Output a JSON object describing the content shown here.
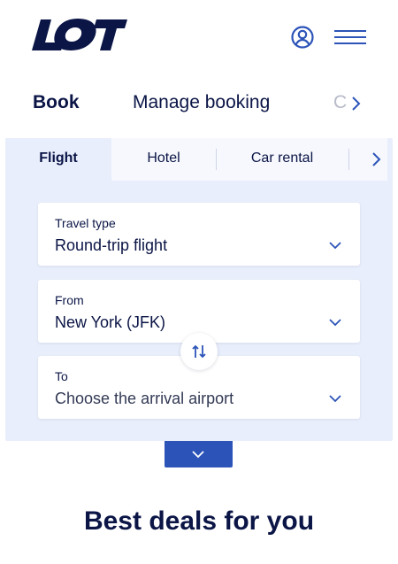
{
  "header": {
    "logo_text": "LOT",
    "user_icon": "user-circle-icon",
    "menu_icon": "hamburger-menu-icon"
  },
  "main_tabs": {
    "items": [
      {
        "label": "Book",
        "active": true
      },
      {
        "label": "Manage booking",
        "active": false
      },
      {
        "label": "C",
        "active": false
      }
    ],
    "next_icon": "chevron-right-icon"
  },
  "booking_panel": {
    "sub_tabs": [
      {
        "label": "Flight",
        "active": true
      },
      {
        "label": "Hotel",
        "active": false
      },
      {
        "label": "Car rental",
        "active": false
      }
    ],
    "fields": {
      "travel_type": {
        "label": "Travel type",
        "value": "Round-trip flight"
      },
      "from": {
        "label": "From",
        "value": "New York (JFK)"
      },
      "to": {
        "label": "To",
        "value": "Choose the arrival airport"
      }
    },
    "swap_icon": "swap-arrows-icon",
    "expand_icon": "chevron-down-icon"
  },
  "deals": {
    "title": "Best deals for you"
  },
  "colors": {
    "brand_navy": "#0b1546",
    "panel_bg": "#e8eefb",
    "tab_strip_bg": "#f6f8fd",
    "accent_blue": "#2c54b8"
  }
}
